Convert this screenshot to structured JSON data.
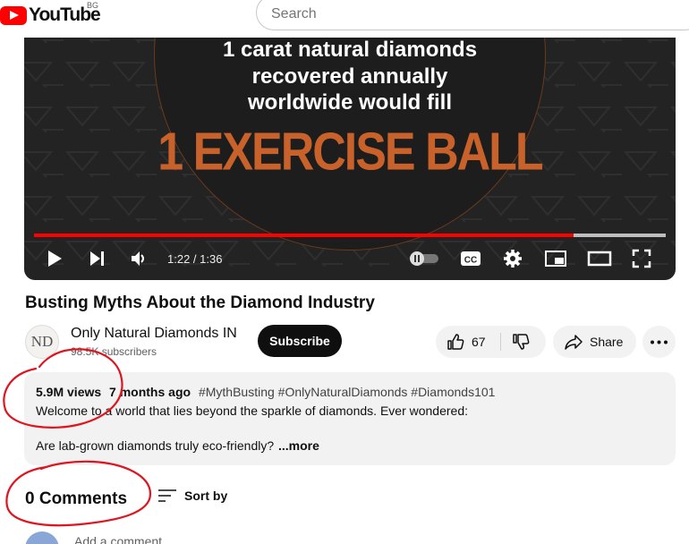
{
  "header": {
    "logo_text": "YouTube",
    "region": "BG",
    "search_placeholder": "Search"
  },
  "player": {
    "overlay_lines": [
      "1 carat natural diamonds",
      "recovered annually",
      "worldwide would fill"
    ],
    "overlay_big": "1 EXERCISE BALL",
    "time": "1:22 / 1:36",
    "progress_fraction": 0.854,
    "buffered_fraction": 1.0
  },
  "video": {
    "title": "Busting Myths About the Diamond Industry"
  },
  "channel": {
    "avatar_text": "ND",
    "name": "Only Natural Diamonds IN",
    "subscribers": "98.5K subscribers",
    "subscribe_label": "Subscribe"
  },
  "actions": {
    "like_count": "67",
    "share_label": "Share"
  },
  "description": {
    "views": "5.9M views",
    "age": "7 months ago",
    "tags": "#MythBusting #OnlyNaturalDiamonds #Diamonds101",
    "line1": "Welcome to a world that lies beyond the sparkle of diamonds. Ever wondered:",
    "line2": "Are lab-grown diamonds truly eco-friendly?",
    "more": "...more"
  },
  "comments": {
    "count_label": "0 Comments",
    "sort_label": "Sort by",
    "add_placeholder": "Add a comment..."
  },
  "colors": {
    "brand_red": "#ff0000",
    "annotation_red": "#e0141e",
    "overlay_orange": "#c8622a"
  }
}
